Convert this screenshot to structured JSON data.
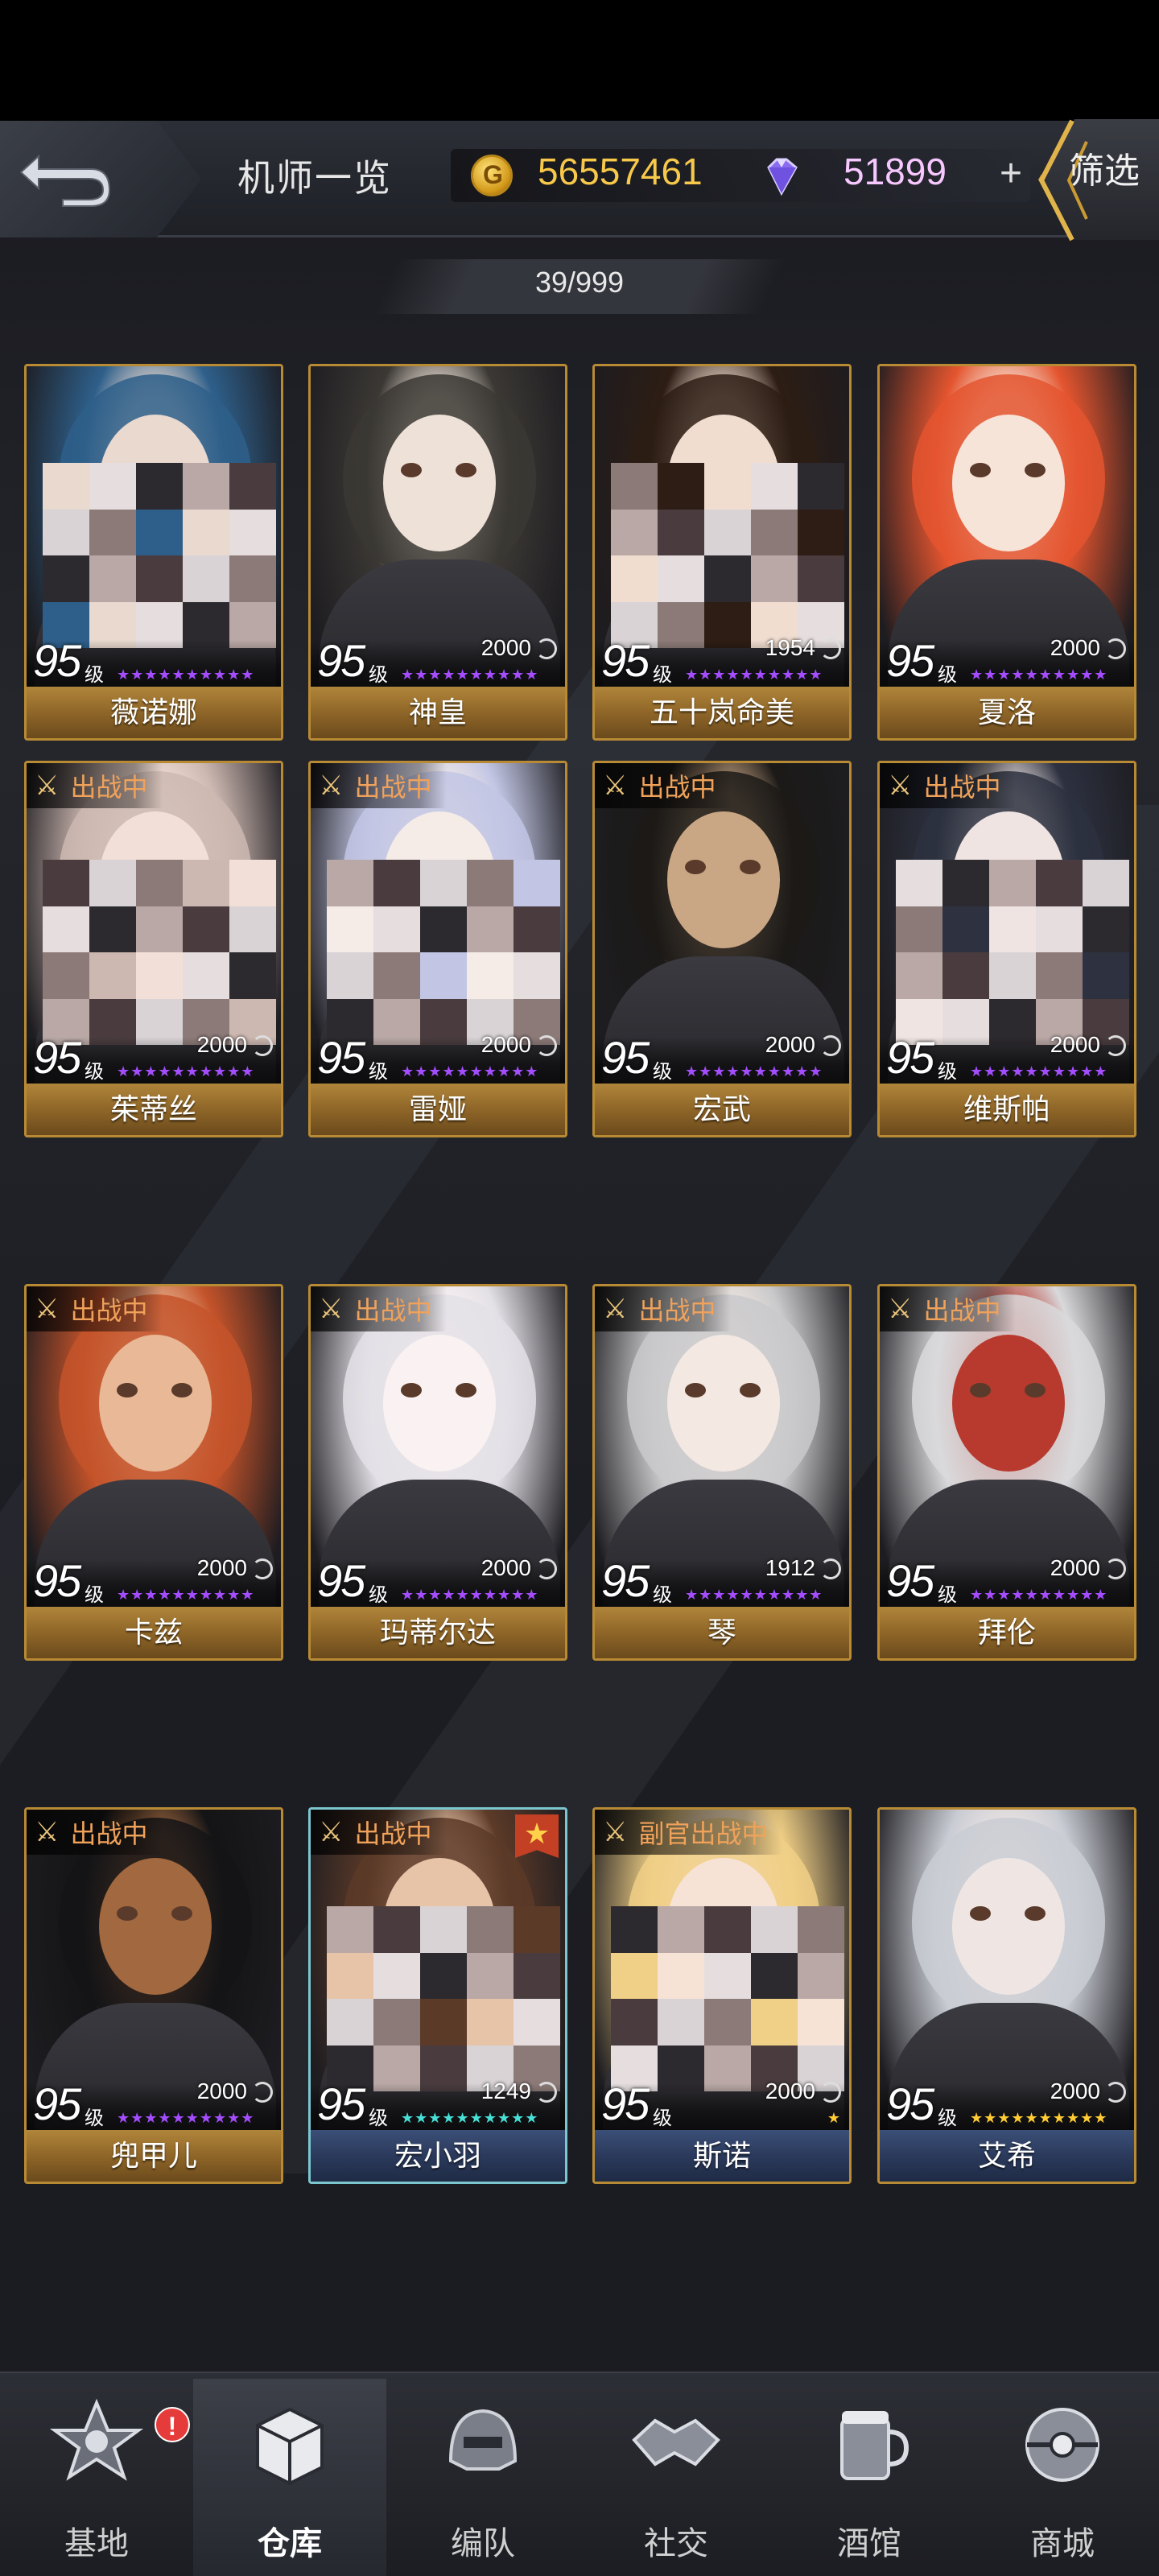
{
  "header": {
    "title": "机师一览",
    "gold": "56557461",
    "gems": "51899",
    "plus": "+",
    "filter": "筛选"
  },
  "counter": "39/999",
  "level_suffix": "级",
  "pilots": [
    {
      "name": "薇诺娜",
      "level": "95",
      "power": "",
      "status": "",
      "stars": "★★★★★★★★★★",
      "star_color": "#a44dff",
      "plate": "gold",
      "hair": "#2e5f8a",
      "skin": "#e9d9cf"
    },
    {
      "name": "神皇",
      "level": "95",
      "power": "2000",
      "status": "",
      "stars": "★★★★★★★★★★",
      "star_color": "#a44dff",
      "plate": "gold",
      "hair": "#3b3834",
      "skin": "#eee2d8"
    },
    {
      "name": "五十岚命美",
      "level": "95",
      "power": "1954",
      "status": "",
      "stars": "★★★★★★★★★★",
      "star_color": "#a44dff",
      "plate": "gold",
      "hair": "#2d1d14",
      "skin": "#f1ddd0"
    },
    {
      "name": "夏洛",
      "level": "95",
      "power": "2000",
      "status": "",
      "stars": "★★★★★★★★★★",
      "star_color": "#a44dff",
      "plate": "gold",
      "hair": "#e4552f",
      "skin": "#f7e4d8"
    },
    {
      "name": "茱蒂丝",
      "level": "95",
      "power": "2000",
      "status": "出战中",
      "stars": "★★★★★★★★★★",
      "star_color": "#a44dff",
      "plate": "gold",
      "hair": "#cdb8b1",
      "skin": "#f2e0d8"
    },
    {
      "name": "雷娅",
      "level": "95",
      "power": "2000",
      "status": "出战中",
      "stars": "★★★★★★★★★★",
      "star_color": "#a44dff",
      "plate": "gold",
      "hair": "#c2c6e4",
      "skin": "#f5ece8"
    },
    {
      "name": "宏武",
      "level": "95",
      "power": "2000",
      "status": "出战中",
      "stars": "★★★★★★★★★★",
      "star_color": "#a44dff",
      "plate": "gold",
      "hair": "#1c1a18",
      "skin": "#c9a684"
    },
    {
      "name": "维斯帕",
      "level": "95",
      "power": "2000",
      "status": "出战中",
      "stars": "★★★★★★★★★★",
      "star_color": "#a44dff",
      "plate": "gold",
      "hair": "#2d3140",
      "skin": "#efe4e2"
    },
    {
      "name": "卡兹",
      "level": "95",
      "power": "2000",
      "status": "出战中",
      "stars": "★★★★★★★★★★",
      "star_color": "#a44dff",
      "plate": "gold",
      "hair": "#c4532a",
      "skin": "#e8b897"
    },
    {
      "name": "玛蒂尔达",
      "level": "95",
      "power": "2000",
      "status": "出战中",
      "stars": "★★★★★★★★★★",
      "star_color": "#a44dff",
      "plate": "gold",
      "hair": "#e3e0e6",
      "skin": "#faf2f2"
    },
    {
      "name": "琴",
      "level": "95",
      "power": "1912",
      "status": "出战中",
      "stars": "★★★★★★★★★★",
      "star_color": "#a44dff",
      "plate": "gold",
      "hair": "#c9c9cb",
      "skin": "#f3e8e2"
    },
    {
      "name": "拜伦",
      "level": "95",
      "power": "2000",
      "status": "出战中",
      "stars": "★★★★★★★★★★",
      "star_color": "#a44dff",
      "plate": "gold",
      "hair": "#d9d9dc",
      "skin": "#b83a2e"
    },
    {
      "name": "兜甲儿",
      "level": "95",
      "power": "2000",
      "status": "出战中",
      "stars": "★★★★★★★★★★",
      "star_color": "#a44dff",
      "plate": "gold",
      "hair": "#141416",
      "skin": "#a2683f"
    },
    {
      "name": "宏小羽",
      "level": "95",
      "power": "1249",
      "status": "出战中",
      "stars": "★★★★★★★★★★",
      "star_color": "#47e0d6",
      "plate": "blue",
      "hair": "#5c3a28",
      "skin": "#e7c4a8"
    },
    {
      "name": "斯诺",
      "level": "95",
      "power": "2000",
      "status": "副官出战中",
      "stars": "★",
      "star_color": "#ffcc33",
      "plate": "blue",
      "hair": "#f0cf86",
      "skin": "#f6e3d6"
    },
    {
      "name": "艾希",
      "level": "95",
      "power": "2000",
      "status": "",
      "stars": "★★★★★★★★★★",
      "star_color": "#ffcc33",
      "plate": "blue",
      "hair": "#c9ccd4",
      "skin": "#efe6e4"
    }
  ],
  "nav": [
    {
      "label": "基地",
      "icon": "base-emblem-icon"
    },
    {
      "label": "仓库",
      "icon": "warehouse-box-icon"
    },
    {
      "label": "编队",
      "icon": "team-helmet-icon"
    },
    {
      "label": "社交",
      "icon": "handshake-icon"
    },
    {
      "label": "酒馆",
      "icon": "tavern-mug-icon"
    },
    {
      "label": "商城",
      "icon": "shop-capsule-icon"
    }
  ],
  "alert": "!"
}
